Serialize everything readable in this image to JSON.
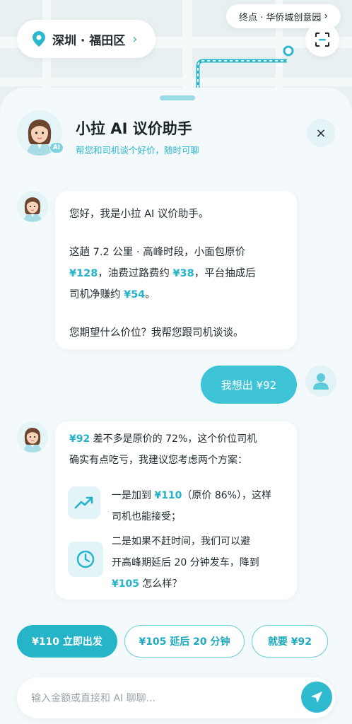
{
  "location": {
    "city": "深圳 · 福田区",
    "chevron": "›"
  },
  "destination": {
    "label": "终点 · 华侨城创意园",
    "chevron": "›"
  },
  "header": {
    "title": "小拉 AI 议价助手",
    "subtitle": "帮您和司机谈个好价，随时可聊",
    "ai_badge": "AI",
    "close_icon": "×"
  },
  "messages": {
    "m1": {
      "greeting": "您好，我是小拉 AI 议价助手。",
      "p2_a": "这趟 7.2 公里 · 高峰时段，小面包原价",
      "p2_price": "¥128",
      "p2_b": "，油费过路费约",
      "p2_fee": "¥38",
      "p2_c": "，平台抽成后",
      "p2_d": "司机净赚约",
      "p2_net": "¥54",
      "p2_e": "。",
      "question": "您期望什么价位？我帮您跟司机谈谈。"
    },
    "user": {
      "text": "我想出 ¥92"
    },
    "m2": {
      "price": "¥92",
      "line1_rest": " 差不多是原价的 72%，这个价位司机",
      "line2": "确实有点吃亏，我建议您考虑两个方案：",
      "opt1_a": "一是加到",
      "opt1_price": "¥110",
      "opt1_b": "（原价 86%），这样",
      "opt1_c": "司机也能接受；",
      "opt2_a": "二是如果不赶时间，我们可以避",
      "opt2_b": "开高峰期延后 20 分钟发车，降到",
      "opt2_price": "¥105",
      "opt2_c": " 怎么样？"
    }
  },
  "quick_replies": {
    "r1": "¥110 立即出发",
    "r2": "¥105 延后 20 分钟",
    "r3": "就要 ¥92"
  },
  "input": {
    "placeholder": "输入金额或直接和 AI 聊聊..."
  },
  "colors": {
    "accent": "#2bb7cc",
    "primary_button": "#26b4c9",
    "user_bubble": "#3fc3d6"
  },
  "icons": [
    "location-pin-icon",
    "scan-icon",
    "close-icon",
    "trend-up-icon",
    "clock-icon",
    "user-icon",
    "send-icon"
  ]
}
